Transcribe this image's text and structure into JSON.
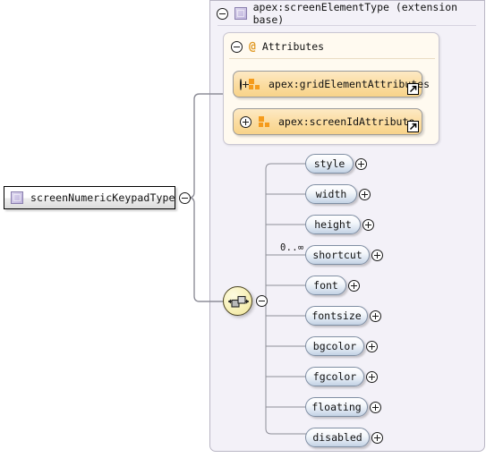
{
  "diagram": {
    "type": "xsd-schema-diagram",
    "root": {
      "label": "screenNumericKeypadType",
      "icon": "complex-type-icon",
      "control": "collapse-minus-icon"
    },
    "base": {
      "label": "apex:screenElementType (extension base)",
      "icon": "complex-type-icon",
      "control": "collapse-minus-icon"
    },
    "attributes": {
      "label": "Attributes",
      "icon": "at-sign-icon",
      "control": "collapse-minus-icon",
      "items": [
        {
          "label": "apex:gridElementAttributes",
          "icon": "attribute-group-icon",
          "control": "expand-plus-icon",
          "link": "external-link-icon"
        },
        {
          "label": "apex:screenIdAttribute",
          "icon": "attribute-group-icon",
          "control": "expand-plus-icon",
          "link": "external-link-icon"
        }
      ]
    },
    "compositor": {
      "kind": "sequence",
      "icon": "sequence-icon",
      "control": "collapse-minus-icon"
    },
    "elements": [
      {
        "label": "style",
        "control": "expand-plus-icon",
        "cardinality": ""
      },
      {
        "label": "width",
        "control": "expand-plus-icon",
        "cardinality": ""
      },
      {
        "label": "height",
        "control": "expand-plus-icon",
        "cardinality": ""
      },
      {
        "label": "shortcut",
        "control": "expand-plus-icon",
        "cardinality": "0..∞"
      },
      {
        "label": "font",
        "control": "expand-plus-icon",
        "cardinality": ""
      },
      {
        "label": "fontsize",
        "control": "expand-plus-icon",
        "cardinality": ""
      },
      {
        "label": "bgcolor",
        "control": "expand-plus-icon",
        "cardinality": ""
      },
      {
        "label": "fgcolor",
        "control": "expand-plus-icon",
        "cardinality": ""
      },
      {
        "label": "floating",
        "control": "expand-plus-icon",
        "cardinality": ""
      },
      {
        "label": "disabled",
        "control": "expand-plus-icon",
        "cardinality": ""
      }
    ],
    "colors": {
      "panel_bg": "#f3f1f8",
      "attributes_bg": "#fffaf0",
      "attribute_item": "#fbdda2",
      "element_pill": "#c3d2e4",
      "sequence_node": "#f7f0b8",
      "type_icon": "#cfc7e6",
      "accent_orange": "#f59b1c",
      "line": "#8e8e98"
    }
  }
}
